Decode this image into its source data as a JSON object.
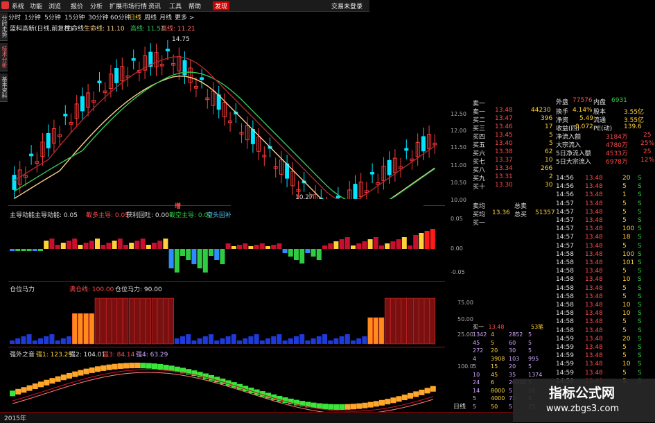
{
  "menu": {
    "items": [
      "系统",
      "功能",
      "浏览",
      "报价",
      "分析",
      "扩展市场行情",
      "资讯",
      "工具",
      "帮助",
      "发现"
    ],
    "login": "交易未登录"
  },
  "periods": [
    "分时",
    "1分钟",
    "5分钟",
    "15分钟",
    "30分钟",
    "60分钟",
    "日线",
    "周线",
    "月线",
    "更多 >"
  ],
  "active_period": "日线",
  "sidetabs": [
    "分时走势",
    "技术分析",
    "基本资料"
  ],
  "main": {
    "title": "蓝科高新(日线,前复权)",
    "ma_label": "生命线",
    "ma1": "生命线: 11.10",
    "ma2": "高线: 11.51",
    "ma3": "高线: 11.21",
    "peak_label": "14.75",
    "low_label": "10.27"
  },
  "price_axis": [
    "12.50",
    "12.00",
    "11.50",
    "11.00",
    "10.50",
    "10.00"
  ],
  "ind1": {
    "title": "主导动能",
    "v1": "主导动能: 0.05",
    "v2": "截多主导: 0.05",
    "v3": "获利回吐: 0.00",
    "v4": "截空主导: 0.00",
    "v5": "空头回补",
    "marker": "增"
  },
  "ind1_axis": [
    "0.05",
    "0.00",
    "-0.05"
  ],
  "ind2": {
    "title": "仓位马力",
    "v1": "满仓线: 100.00",
    "v2": "仓位马力: 90.00"
  },
  "ind2_axis": [
    "75.00",
    "50.00",
    "25.00"
  ],
  "ind3": {
    "title": "强外之音",
    "v1": "强1: 123.29",
    "v2": "强2: 104.01",
    "v3": "强3: 84.14",
    "v4": "强4: 63.29"
  },
  "ind3_axis": [
    "100.0"
  ],
  "bottom": {
    "year": "2015年",
    "period": "日线"
  },
  "quote": {
    "outer_label": "外盘",
    "outer_val": "77576",
    "inner_label": "内盘",
    "inner_val": "6931",
    "sell1_label": "卖一",
    "turnover_label": "换手",
    "turnover_val": "4.14%",
    "shares_label": "股本",
    "shares_val": "3.55亿",
    "netasset_label": "净资",
    "netasset_val": "5.49",
    "float_label": "流通",
    "float_val": "3.55亿",
    "eps_label": "收益(四)",
    "eps_val": "0.072",
    "pe_label": "PE(动)",
    "pe_val": "139.6",
    "flow": [
      {
        "label": "净流入额",
        "val": "3184万",
        "pct": "25"
      },
      {
        "label": "大宗流入",
        "val": "4780万",
        "pct": "25%"
      },
      {
        "label": "5日净流入额",
        "val": "4533万",
        "pct": "25"
      },
      {
        "label": "5日大宗流入",
        "val": "6978万",
        "pct": "12%"
      }
    ],
    "asks": [
      {
        "label": "卖一",
        "price": "13.48",
        "vol": "44230"
      },
      {
        "label": "买二",
        "price": "13.47",
        "vol": "396"
      },
      {
        "label": "买三",
        "price": "13.46",
        "vol": "17"
      },
      {
        "label": "买四",
        "price": "13.45",
        "vol": "5"
      },
      {
        "label": "买五",
        "price": "13.40",
        "vol": "5"
      },
      {
        "label": "买六",
        "price": "13.38",
        "vol": "62"
      },
      {
        "label": "买七",
        "price": "13.37",
        "vol": "10"
      },
      {
        "label": "买八",
        "price": "13.34",
        "vol": "266"
      },
      {
        "label": "买九",
        "price": "13.31",
        "vol": "2"
      },
      {
        "label": "买十",
        "price": "13.30",
        "vol": "30"
      }
    ],
    "avg_label": "卖均",
    "total_sell_label": "总卖",
    "buyavg_label": "买均",
    "buyavg_val": "13.36",
    "total_buy_label": "总买",
    "total_buy_val": "51357",
    "buy1_label": "买一"
  },
  "ticks": [
    {
      "t": "14:56",
      "p": "13.48",
      "v": "20",
      "d": "S"
    },
    {
      "t": "14:56",
      "p": "13.48",
      "v": "5",
      "d": "S"
    },
    {
      "t": "14:56",
      "p": "13.48",
      "v": "1",
      "d": "S"
    },
    {
      "t": "14:57",
      "p": "13.48",
      "v": "5",
      "d": "S"
    },
    {
      "t": "14:57",
      "p": "13.48",
      "v": "5",
      "d": "S"
    },
    {
      "t": "14:57",
      "p": "13.48",
      "v": "5",
      "d": "S"
    },
    {
      "t": "14:57",
      "p": "13.48",
      "v": "100",
      "d": "S"
    },
    {
      "t": "14:57",
      "p": "13.48",
      "v": "18",
      "d": "S"
    },
    {
      "t": "14:57",
      "p": "13.48",
      "v": "5",
      "d": "S"
    },
    {
      "t": "14:58",
      "p": "13.48",
      "v": "100",
      "d": "S"
    },
    {
      "t": "14:58",
      "p": "13.48",
      "v": "101",
      "d": "S"
    },
    {
      "t": "14:58",
      "p": "13.48",
      "v": "5",
      "d": "S"
    },
    {
      "t": "14:58",
      "p": "13.48",
      "v": "10",
      "d": "S"
    },
    {
      "t": "14:58",
      "p": "13.48",
      "v": "5",
      "d": "S"
    },
    {
      "t": "14:58",
      "p": "13.48",
      "v": "5",
      "d": "S"
    },
    {
      "t": "14:58",
      "p": "13.48",
      "v": "10",
      "d": "S"
    },
    {
      "t": "14:58",
      "p": "13.48",
      "v": "10",
      "d": "S"
    },
    {
      "t": "14:58",
      "p": "13.48",
      "v": "5",
      "d": "S"
    },
    {
      "t": "14:58",
      "p": "13.48",
      "v": "5",
      "d": "S"
    },
    {
      "t": "14:59",
      "p": "13.48",
      "v": "20",
      "d": "S"
    },
    {
      "t": "14:59",
      "p": "13.48",
      "v": "5",
      "d": "S"
    },
    {
      "t": "14:59",
      "p": "13.48",
      "v": "5",
      "d": "S"
    },
    {
      "t": "14:59",
      "p": "13.48",
      "v": "10",
      "d": "S"
    },
    {
      "t": "14:59",
      "p": "13.48",
      "v": "5",
      "d": "S"
    },
    {
      "t": "14:59",
      "p": "13.48",
      "v": "5",
      "d": "S"
    }
  ],
  "brk_head": {
    "label": "买一",
    "price": "13.48",
    "vol": "53笔"
  },
  "brk_rows": [
    [
      "1342",
      "4",
      "2852",
      "5"
    ],
    [
      "45",
      "5",
      "60",
      "5"
    ],
    [
      "272",
      "20",
      "30",
      "5"
    ],
    [
      "4",
      "3908",
      "103",
      "995"
    ],
    [
      "5",
      "15",
      "20",
      "5"
    ],
    [
      "10",
      "45",
      "35",
      "1374"
    ],
    [
      "24",
      "6",
      "20000",
      "5"
    ],
    [
      "14",
      "8000",
      "5",
      "10"
    ],
    [
      "5",
      "4000",
      "72",
      "5"
    ],
    [
      "5",
      "50",
      "5",
      "25"
    ]
  ],
  "watermark": {
    "line1": "指标公式网",
    "line2": "www.zbgs3.com"
  },
  "colors": {
    "up": "#ff3b3b",
    "down": "#00e5ff",
    "ma_yellow": "#ffd48a",
    "ma_green": "#35c85a",
    "ma_red": "#b3262b"
  }
}
